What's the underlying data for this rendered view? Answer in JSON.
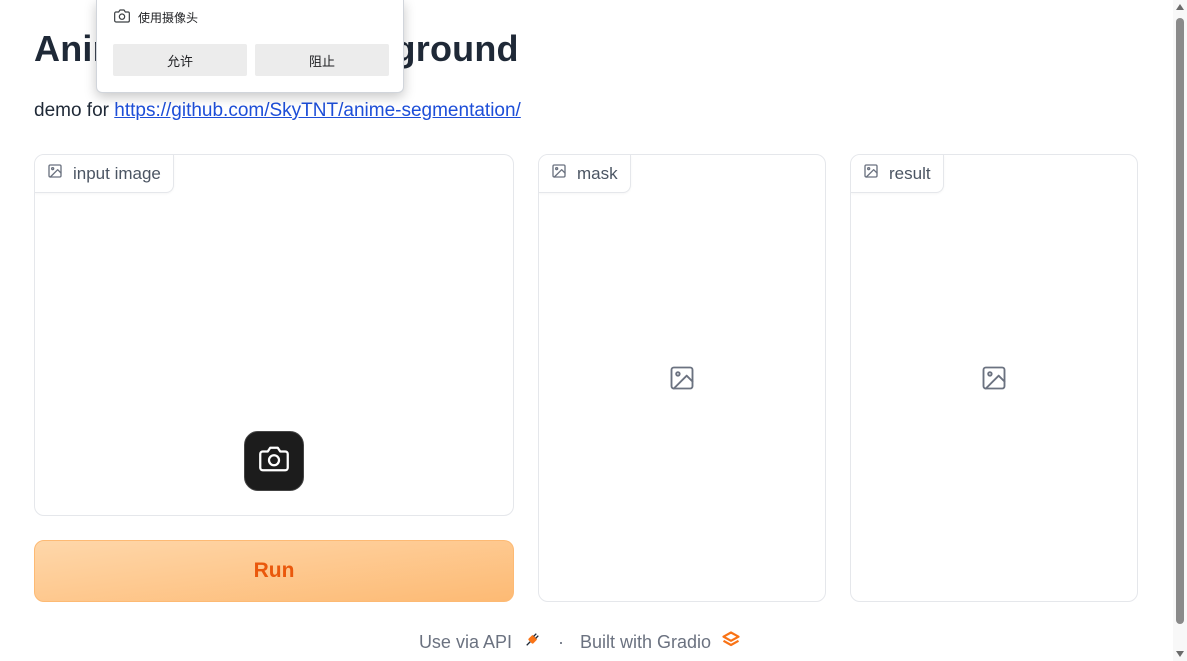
{
  "page": {
    "title": "Anime Remove Background",
    "description_prefix": "demo for ",
    "description_link": "https://github.com/SkyTNT/anime-segmentation/"
  },
  "panels": {
    "input": {
      "label": "input image",
      "icon": "image-icon"
    },
    "mask": {
      "label": "mask",
      "icon": "image-icon"
    },
    "result": {
      "label": "result",
      "icon": "image-icon"
    }
  },
  "actions": {
    "run_label": "Run",
    "camera_icon": "camera-icon"
  },
  "footer": {
    "api_label": "Use via API",
    "separator": "·",
    "built_label": "Built with Gradio"
  },
  "permission_prompt": {
    "text": "使用摄像头",
    "allow_label": "允许",
    "block_label": "阻止"
  },
  "colors": {
    "run_text": "#ea580c",
    "run_bg_from": "#fed7aa",
    "run_bg_to": "#fdba74",
    "link": "#1d4ed8",
    "gradio_logo": "#f97316"
  }
}
